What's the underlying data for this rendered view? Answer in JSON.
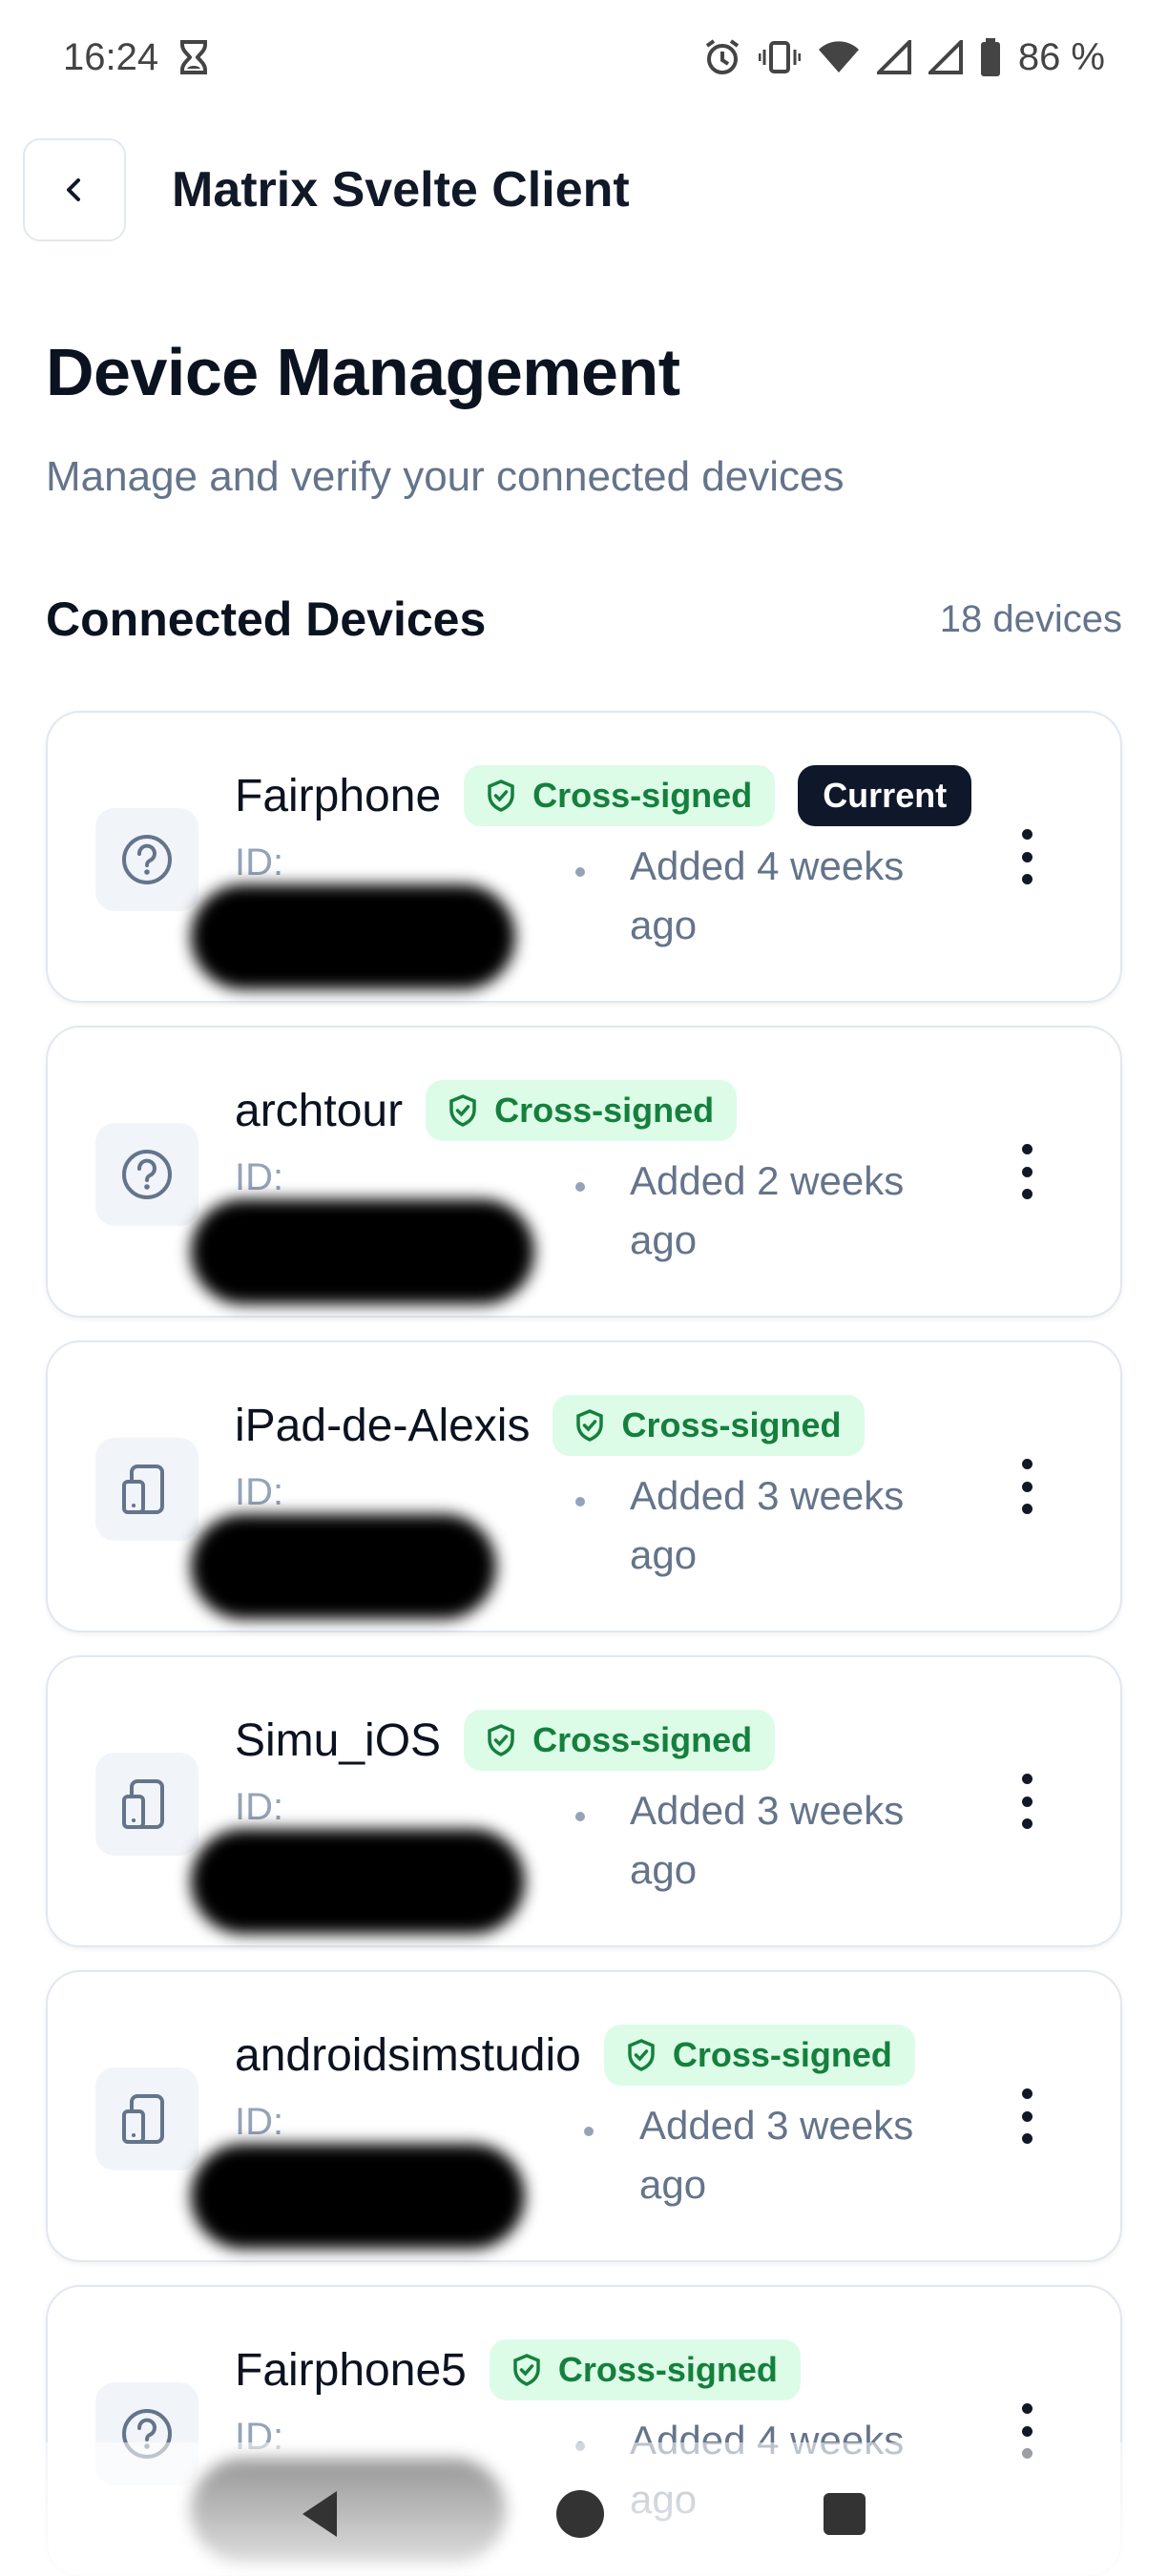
{
  "status": {
    "time": "16:24",
    "battery": "86 %"
  },
  "header": {
    "app_title": "Matrix Svelte Client"
  },
  "page": {
    "title": "Device Management",
    "subtitle": "Manage and verify your connected devices"
  },
  "section": {
    "title": "Connected Devices",
    "count": "18 devices"
  },
  "devices": [
    {
      "name": "Fairphone",
      "icon": "question-icon",
      "verified_label": "Cross-signed",
      "current_label": "Current",
      "id_label": "ID:",
      "added": "Added 4 weeks ago"
    },
    {
      "name": "archtour",
      "icon": "question-icon",
      "verified_label": "Cross-signed",
      "id_label": "ID:",
      "added": "Added 2 weeks ago"
    },
    {
      "name": "iPad-de-Alexis",
      "icon": "tablet-icon",
      "verified_label": "Cross-signed",
      "id_label": "ID:",
      "added": "Added 3 weeks ago"
    },
    {
      "name": "Simu_iOS",
      "icon": "tablet-icon",
      "verified_label": "Cross-signed",
      "id_label": "ID:",
      "added": "Added 3 weeks ago"
    },
    {
      "name": "androidsimstudio",
      "icon": "tablet-icon",
      "verified_label": "Cross-signed",
      "id_label": "ID:",
      "added": "Added 3 weeks ago"
    },
    {
      "name": "Fairphone5",
      "icon": "question-icon",
      "verified_label": "Cross-signed",
      "id_label": "ID:",
      "added": "Added 4 weeks ago"
    }
  ],
  "colors": {
    "verified_bg": "#dcfce7",
    "verified_text": "#15803d",
    "current_bg": "#0f172a",
    "muted_text": "#64748b"
  }
}
